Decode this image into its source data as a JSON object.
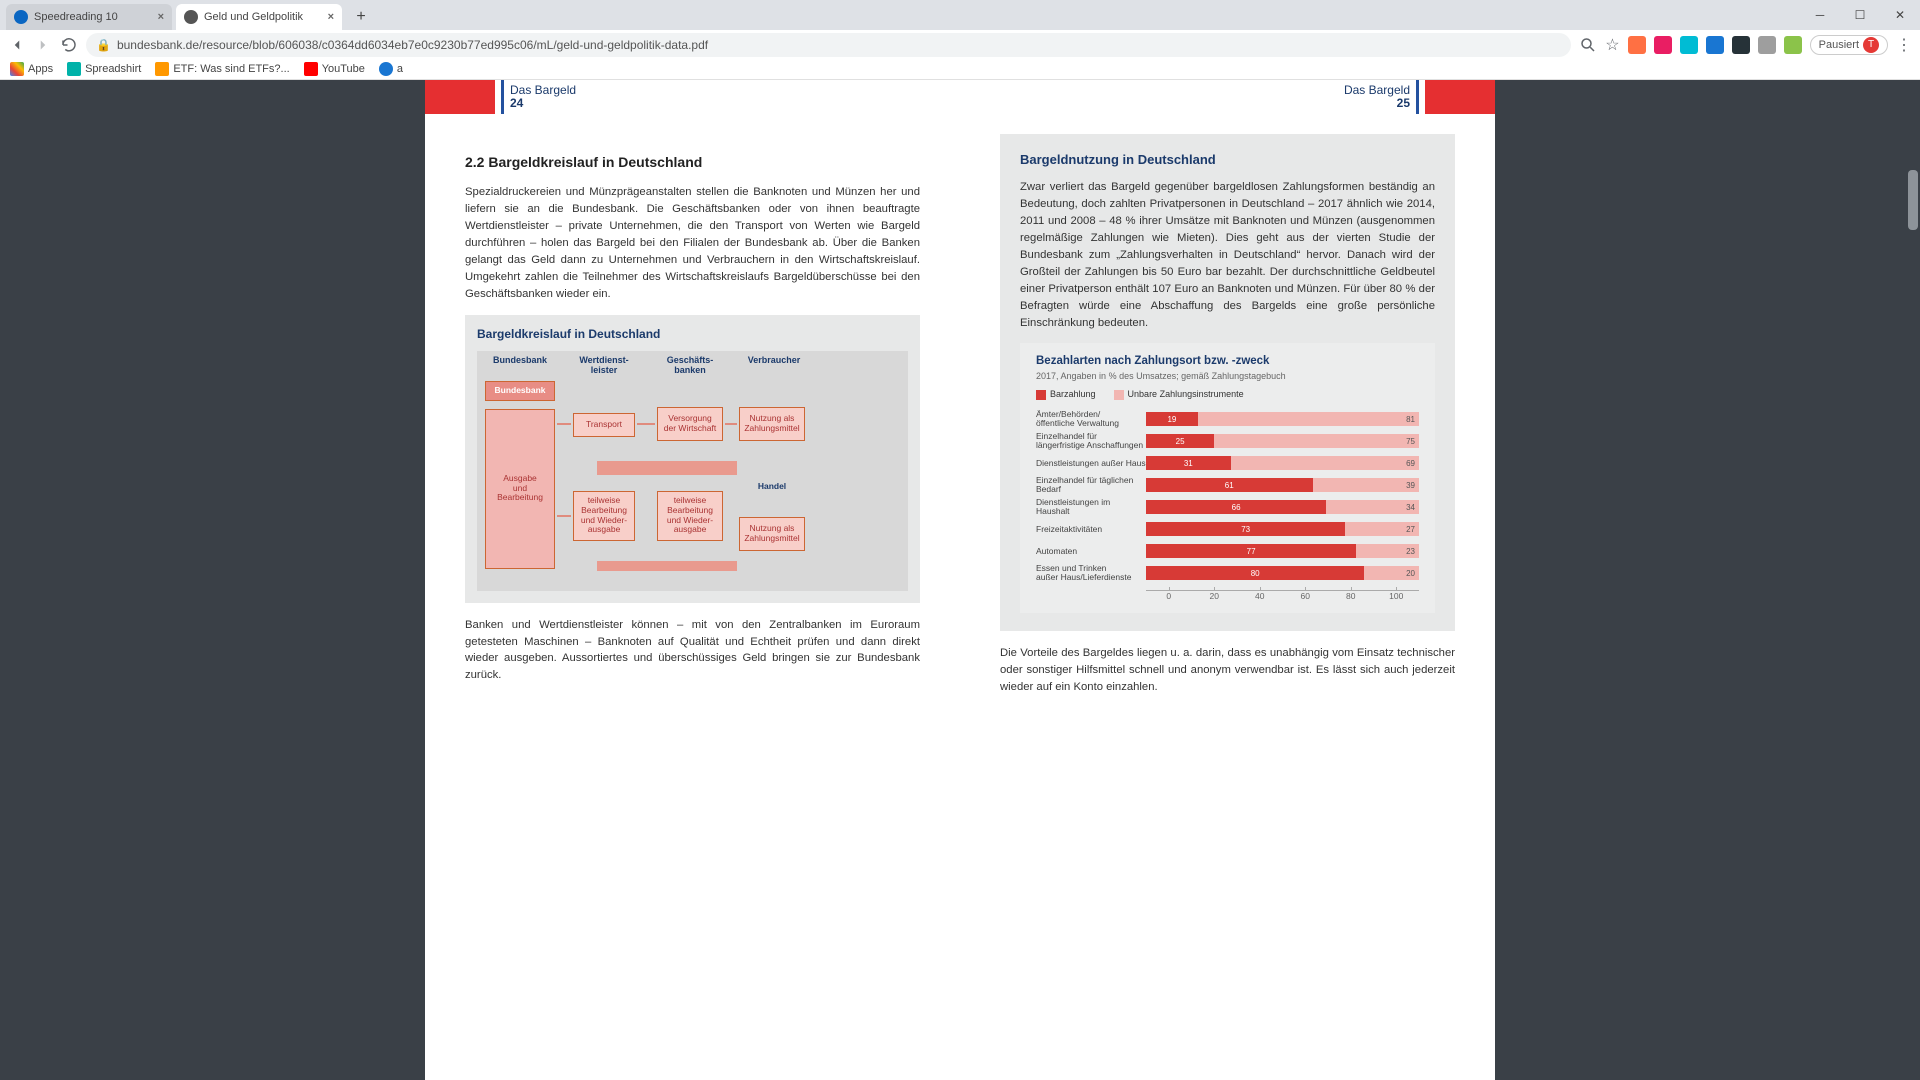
{
  "browser": {
    "tabs": [
      {
        "title": "Speedreading 10",
        "active": false
      },
      {
        "title": "Geld und Geldpolitik",
        "active": true
      }
    ],
    "url": "bundesbank.de/resource/blob/606038/c0364dd6034eb7e0c9230b77ed995c06/mL/geld-und-geldpolitik-data.pdf",
    "paused": "Pausiert",
    "avatar": "T",
    "bookmarks": [
      {
        "label": "Apps"
      },
      {
        "label": "Spreadshirt"
      },
      {
        "label": "ETF: Was sind ETFs?..."
      },
      {
        "label": "YouTube"
      },
      {
        "label": "a"
      }
    ]
  },
  "doc": {
    "running_head": "Das Bargeld",
    "page_left": "24",
    "page_right": "25",
    "left": {
      "heading": "2.2 Bargeldkreislauf in Deutschland",
      "p1": "Spezialdruckereien und Münzprägeanstalten stellen die Banknoten und Münzen her und liefern sie an die Bundesbank. Die Geschäftsbanken oder von ihnen beauftragte Wertdienstleister – private Unternehmen, die den Transport von Werten wie Bargeld durchführen – holen das Bargeld bei den Filialen der Bundesbank ab. Über die Banken gelangt das Geld dann zu Unternehmen und Verbrauchern in den Wirtschaftskreislauf. Umgekehrt zahlen die Teilnehmer des Wirtschaftskreislaufs Bargeldüberschüsse bei den Geschäftsbanken wieder ein.",
      "diagram": {
        "title": "Bargeldkreislauf in Deutschland",
        "cols": [
          "Bundesbank",
          "Wertdienst-\nleister",
          "Geschäfts-\nbanken",
          "Verbraucher"
        ],
        "nodes": {
          "bb": "Bundesbank",
          "ausgabe": "Ausgabe\nund\nBearbeitung",
          "transport": "Transport",
          "versorgung": "Versorgung\nder Wirtschaft",
          "nutz1": "Nutzung als\nZahlungsmittel",
          "teil1": "teilweise\nBearbeitung\nund Wieder-\nausgabe",
          "teil2": "teilweise\nBearbeitung\nund Wieder-\nausgabe",
          "handel": "Handel",
          "nutz2": "Nutzung als\nZahlungsmittel"
        }
      },
      "p2": "Banken und Wertdienstleister können – mit von den Zentralbanken im Euroraum getesteten Maschinen – Banknoten auf Qualität und Echtheit prüfen und dann direkt wieder ausgeben. Aussortiertes und überschüssiges Geld bringen sie zur Bundesbank zurück."
    },
    "right": {
      "box_title": "Bargeldnutzung in Deutschland",
      "box_p1": "Zwar verliert das Bargeld gegenüber bargeldlosen Zahlungsformen be­ständig an Bedeutung, doch zahlten Privatpersonen in Deutschland – 2017 ähnlich wie 2014, 2011 und 2008 – 48 % ihrer Umsätze mit Banknoten und Münzen (ausgenommen regelmäßige Zahlungen wie Mieten). Dies geht aus der vierten Studie der Bundesbank zum „Zah­lungsverhalten in Deutschland“ hervor. Danach wird der Großteil der Zahlungen bis 50 Euro bar bezahlt. Der durchschnittliche Geldbeutel einer Privatperson enthält 107 Euro an Banknoten und Münzen. Für über 80 % der Befragten würde eine Abschaffung des Bargelds eine große persönliche Einschränkung bedeuten.",
      "box_p2": "Die Vorteile des Bargeldes liegen u. a. darin, dass es unabhängig vom Einsatz technischer oder sonstiger Hilfsmittel schnell und anonym ver­wendbar ist. Es lässt sich auch jederzeit wieder auf ein Konto einzahlen."
    }
  },
  "chart_data": {
    "type": "bar",
    "title": "Bezahlarten nach Zahlungsort bzw. -zweck",
    "subtitle": "2017, Angaben in % des Umsatzes; gemäß Zahlungstagebuch",
    "series": [
      {
        "name": "Barzahlung",
        "color": "#d73a36"
      },
      {
        "name": "Unbare Zahlungsinstrumente",
        "color": "#f2b6b2"
      }
    ],
    "categories": [
      "Ämter/Behörden/\nöffentliche Verwaltung",
      "Einzelhandel für\nlängerfristige Anschaffungen",
      "Dienstleistungen außer Haus",
      "Einzelhandel für täglichen\nBedarf",
      "Dienstleistungen im Haushalt",
      "Freizeitaktivitäten",
      "Automaten",
      "Essen und Trinken\naußer Haus/Lieferdienste"
    ],
    "values_cash": [
      19,
      25,
      31,
      61,
      66,
      73,
      77,
      80
    ],
    "values_noncash": [
      81,
      75,
      69,
      39,
      34,
      27,
      23,
      20
    ],
    "xticks": [
      0,
      20,
      40,
      60,
      80,
      100
    ],
    "xlabel": "",
    "ylabel": "",
    "xlim": [
      0,
      100
    ]
  }
}
